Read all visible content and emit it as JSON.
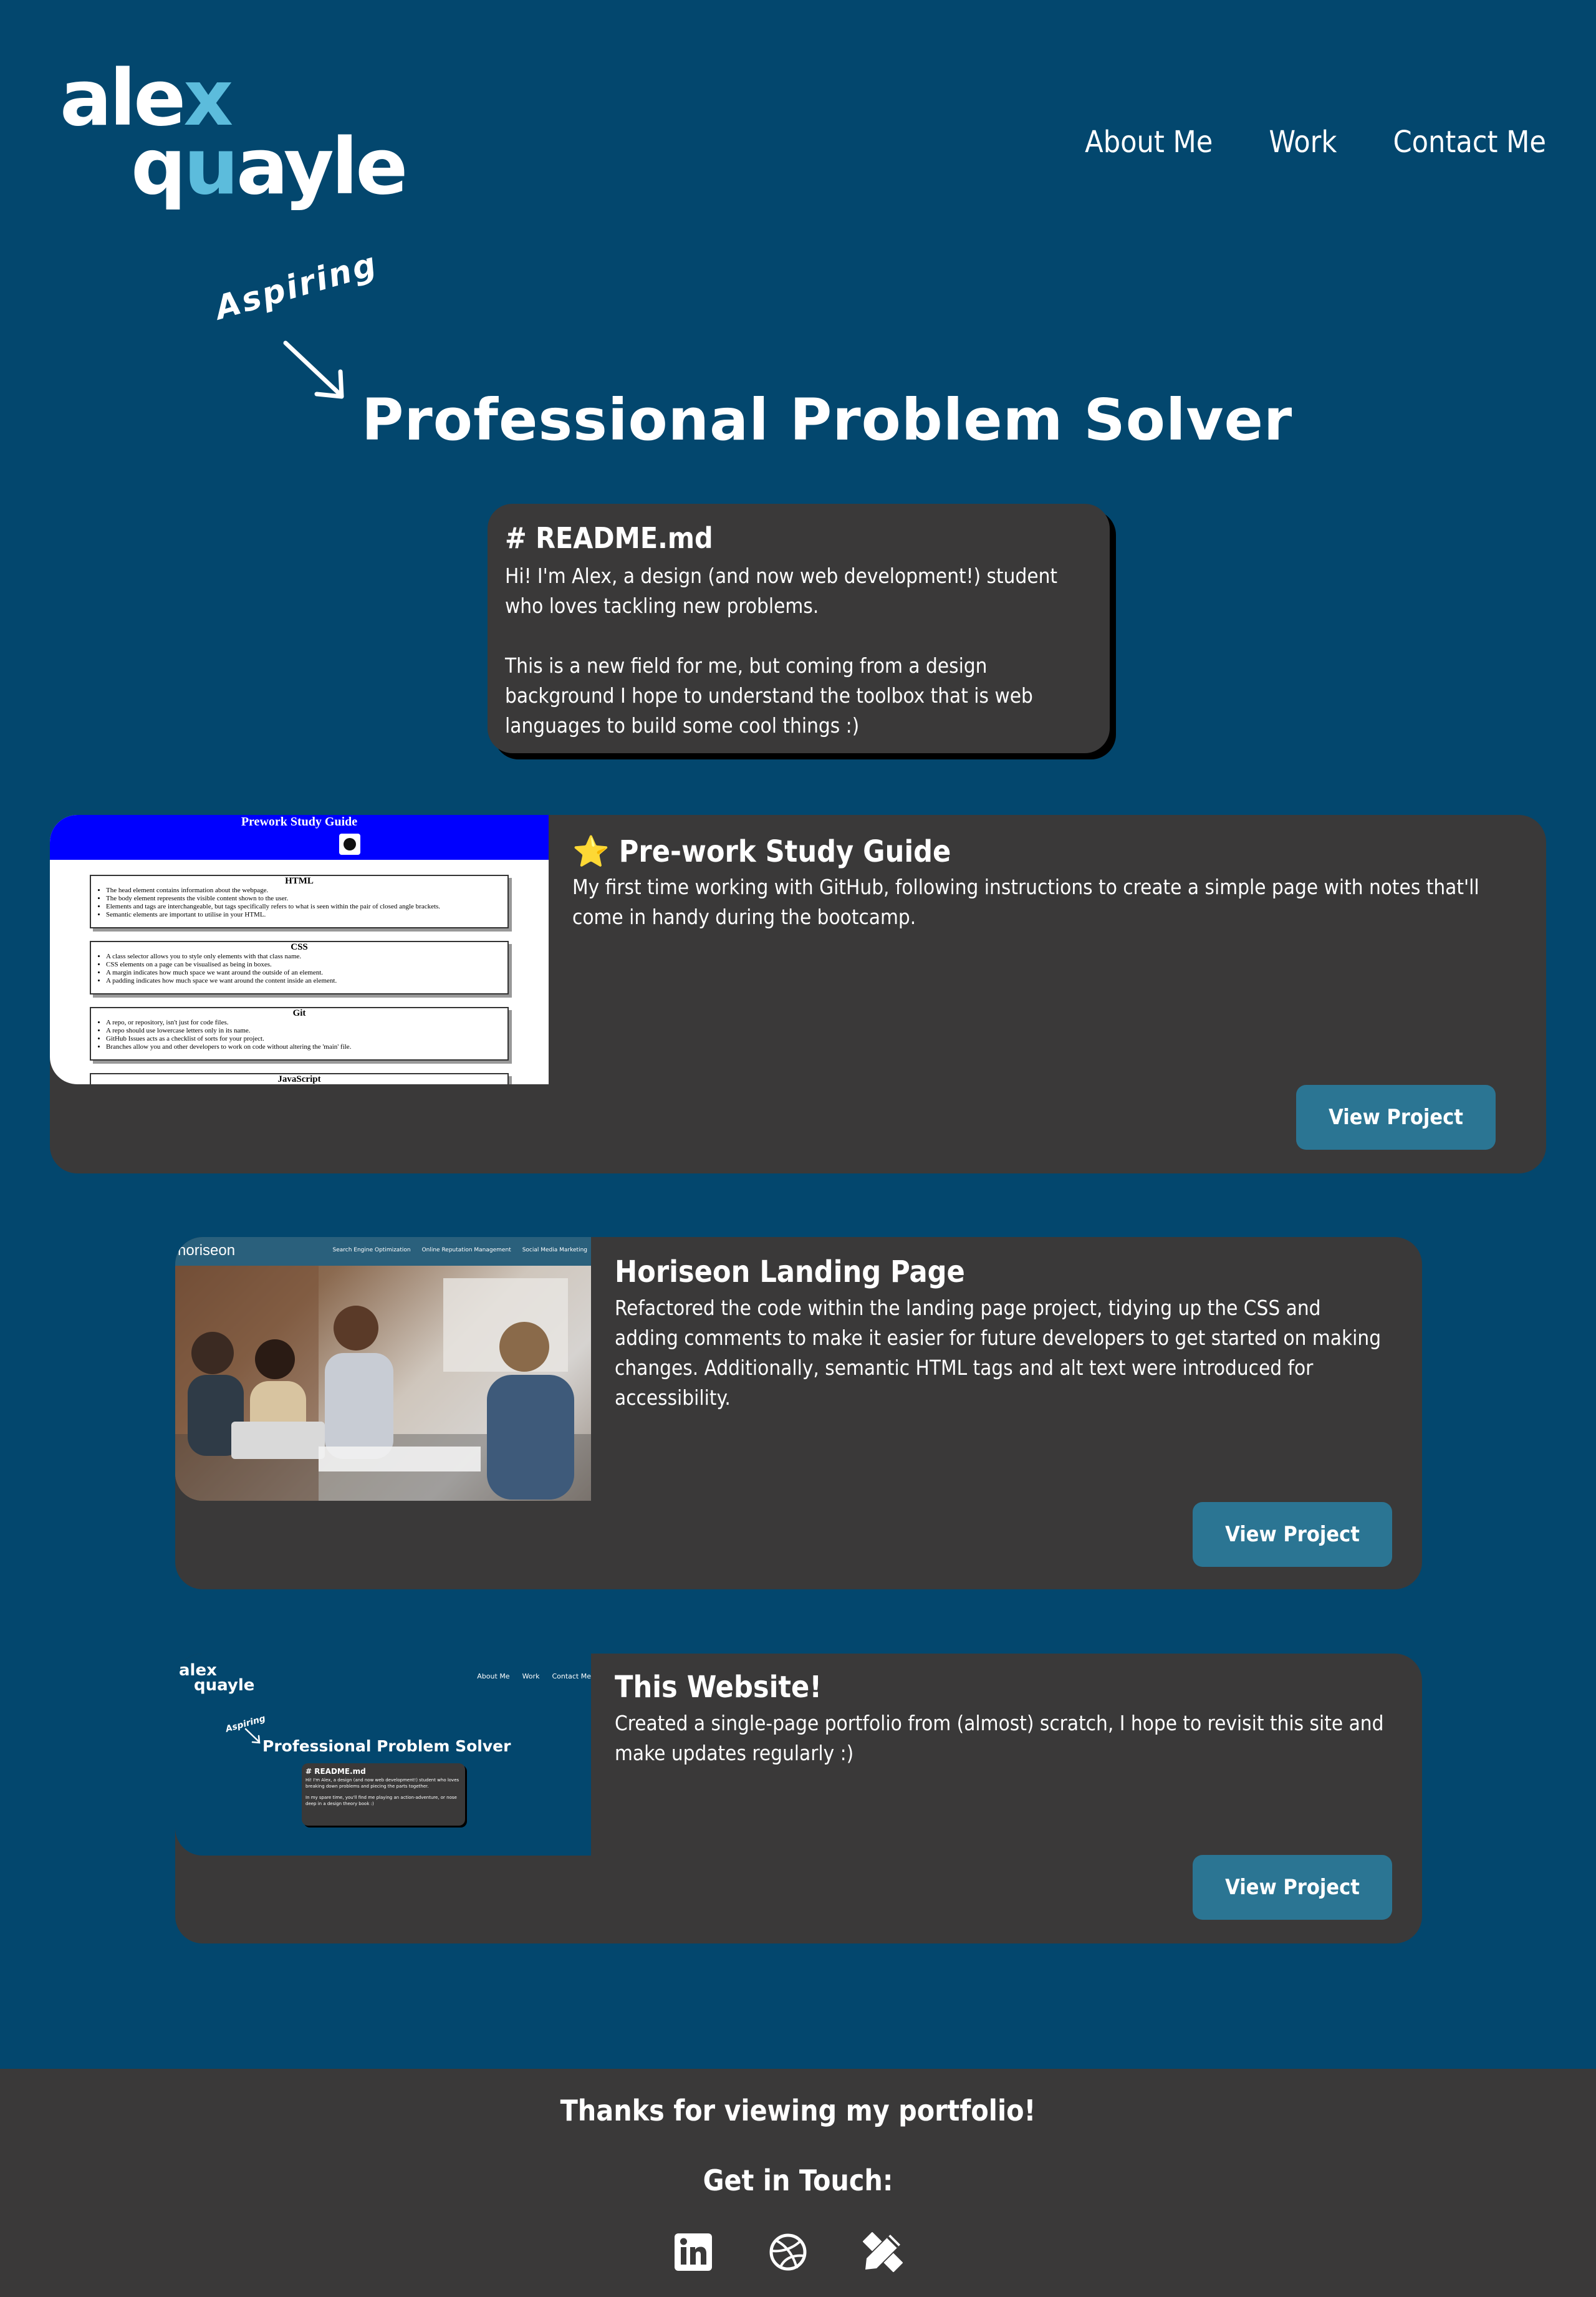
{
  "header": {
    "logo": {
      "line1_main": "ale",
      "line1_accent": "x",
      "line2_pre": "q",
      "line2_accent": "u",
      "line2_post": "ayle"
    },
    "nav": [
      "About Me",
      "Work",
      "Contact Me"
    ]
  },
  "hero": {
    "tagline": "Aspiring",
    "title": "Professional Problem Solver"
  },
  "readme": {
    "title": "# README.md",
    "paragraph1": "Hi! I'm Alex, a design (and now web development!) student who loves tackling new problems.",
    "paragraph2": "This is a new field for me, but coming from a design background I hope to understand the toolbox that is web languages to build some cool things :)"
  },
  "projects": [
    {
      "title": "⭐ Pre-work Study Guide",
      "description": "My first time working with GitHub, following instructions to create a simple page with notes that'll come in handy during the bootcamp.",
      "button": "View Project",
      "thumbnail": {
        "title": "Prework Study Guide",
        "sections": [
          {
            "heading": "HTML",
            "items": [
              "The head element contains information about the webpage.",
              "The body element represents the visible content shown to the user.",
              "Elements and tags are interchangeable, but tags specifically refers to what is seen within the pair of closed angle brackets.",
              "Semantic elements are important to utilise in your HTML."
            ]
          },
          {
            "heading": "CSS",
            "items": [
              "A class selector allows you to style only elements with that class name.",
              "CSS elements on a page can be visualised as being in boxes.",
              "A margin indicates how much space we want around the outside of an element.",
              "A padding indicates how much space we want around the content inside an element."
            ]
          },
          {
            "heading": "Git",
            "items": [
              "A repo, or repository, isn't just for code files.",
              "A repo should use lowercase letters only in its name.",
              "GitHub Issues acts as a checklist of sorts for your project.",
              "Branches allow you and other developers to work on code without altering the 'main' file."
            ]
          },
          {
            "heading": "JavaScript",
            "items": []
          }
        ]
      }
    },
    {
      "title": "Horiseon Landing Page",
      "description": "Refactored the code within the landing page project, tidying up the CSS and adding comments to make it easier for future developers to get started on making changes. Additionally, semantic HTML tags and alt text were introduced for accessibility.",
      "button": "View Project",
      "thumbnail": {
        "brand": "horiseon",
        "links": [
          "Search Engine Optimization",
          "Online Reputation Management",
          "Social Media Marketing"
        ]
      }
    },
    {
      "title": "This Website!",
      "description": "Created a single-page portfolio from (almost) scratch, I hope to revisit this site and make updates regularly :)",
      "button": "View Project",
      "thumbnail": {
        "logo1": "alex",
        "logo2": "quayle",
        "nav": [
          "About Me",
          "Work",
          "Contact Me"
        ],
        "tagline": "Aspiring",
        "title": "Professional Problem Solver",
        "card_title": "# README.md",
        "card_p1": "Hi! I'm Alex, a design (and now web development!) student who loves breaking down problems and piecing the parts together.",
        "card_p2": "In my spare time, you'll find me playing an action-adventure, or nose deep in a design theory book :)"
      }
    }
  ],
  "footer": {
    "thanks": "Thanks for viewing my portfolio!",
    "get_in_touch": "Get in Touch:",
    "socials": [
      "linkedin-icon",
      "dribbble-icon",
      "design-tools-icon"
    ]
  },
  "colors": {
    "background": "#03476e",
    "card": "#3a3939",
    "button": "#2b7593",
    "accent": "#5cbcdc"
  }
}
